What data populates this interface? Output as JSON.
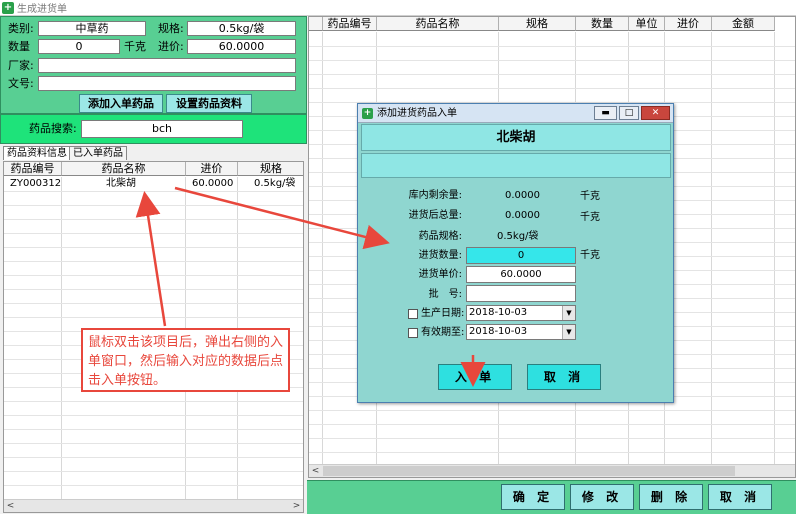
{
  "window": {
    "title": "生成进货单"
  },
  "form": {
    "category_label": "类别:",
    "category_value": "中草药",
    "spec_label": "规格:",
    "spec_value": "0.5kg/袋",
    "qty_label": "数量",
    "qty_value": "0",
    "qty_unit": "千克",
    "price_label": "进价:",
    "price_value": "60.0000",
    "maker_label": "厂家:",
    "maker_value": "",
    "doc_label": "文号:",
    "doc_value": "",
    "add_button": "添加入单药品",
    "setup_button": "设置药品资料"
  },
  "search": {
    "label": "药品搜索:",
    "value": "bch"
  },
  "tabs": [
    {
      "label": "药品资料信息"
    },
    {
      "label": "已入单药品"
    }
  ],
  "left_grid": {
    "headers": [
      "药品编号",
      "药品名称",
      "进价",
      "规格"
    ],
    "rows": [
      [
        "ZY000312",
        "北柴胡",
        "60.0000",
        "0.5kg/袋"
      ]
    ]
  },
  "right_grid": {
    "headers": [
      "药品编号",
      "药品名称",
      "规格",
      "数量",
      "单位",
      "进价",
      "金额"
    ]
  },
  "bottom_buttons": [
    "确 定",
    "修 改",
    "删 除",
    "取 消"
  ],
  "dialog": {
    "title": "添加进货药品入单",
    "drug_name": "北柴胡",
    "stock_label": "库内剩余量:",
    "stock_value": "0.0000",
    "stock_unit": "千克",
    "after_label": "进货后总量:",
    "after_value": "0.0000",
    "after_unit": "千克",
    "spec_label": "药品规格:",
    "spec_value": "0.5kg/袋",
    "qty_label": "进货数量:",
    "qty_value": "0",
    "qty_unit": "千克",
    "price_label": "进货单价:",
    "price_value": "60.0000",
    "batch_label": "批　号:",
    "batch_value": "",
    "prod_label": "生产日期:",
    "prod_date": "2018-10-03",
    "exp_label": "有效期至:",
    "exp_date": "2018-10-03",
    "ok_button": "入 单",
    "cancel_button": "取 消"
  },
  "annotation": {
    "text": "鼠标双击该项目后，弹出右侧的入单窗口，然后输入对应的数据后点击入单按钮。"
  },
  "colors": {
    "panel_green": "#58cf93",
    "search_green": "#1ee37a",
    "dialog_teal": "#8fd6d0",
    "button_cyan": "#9be7e6",
    "annotation_red": "#e8473c"
  }
}
